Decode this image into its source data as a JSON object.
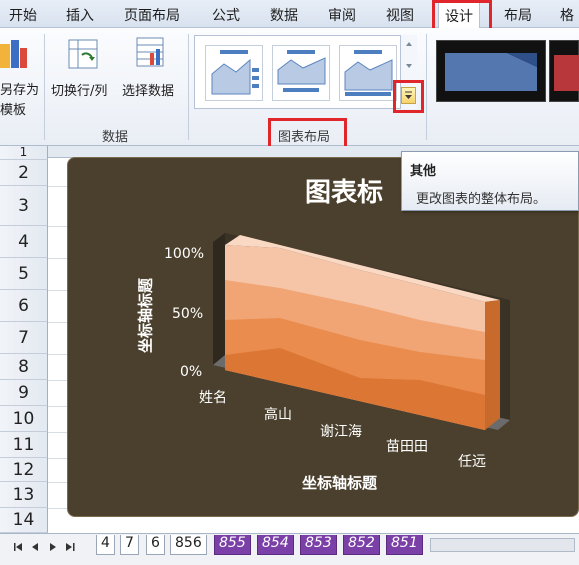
{
  "ribbon_tabs": [
    {
      "label": "开始"
    },
    {
      "label": "插入"
    },
    {
      "label": "页面布局"
    },
    {
      "label": "公式"
    },
    {
      "label": "数据"
    },
    {
      "label": "审阅"
    },
    {
      "label": "视图"
    },
    {
      "label": "设计",
      "active": true
    },
    {
      "label": "布局"
    },
    {
      "label": "格"
    }
  ],
  "ribbon": {
    "save_template_line1": "另存为",
    "save_template_line2": "模板",
    "switch_row_col": "切换行/列",
    "select_data": "选择数据",
    "group_data": "数据",
    "group_chart_layouts": "图表布局"
  },
  "tooltip": {
    "title": "其他",
    "description": "更改图表的整体布局。"
  },
  "rows": [
    "1",
    "2",
    "3",
    "4",
    "5",
    "6",
    "7",
    "8",
    "9",
    "10",
    "11",
    "12",
    "13",
    "14"
  ],
  "chart_data": {
    "type": "area",
    "title": "图表标",
    "xlabel": "坐标轴标题",
    "ylabel": "坐标轴标题",
    "categories": [
      "姓名",
      "高山",
      "谢江海",
      "苗田田",
      "任远"
    ],
    "y_ticks": [
      "100%",
      "50%",
      "0%"
    ],
    "ylim": [
      0,
      1
    ]
  },
  "sheet_tabs": [
    {
      "label": "4"
    },
    {
      "label": "7"
    },
    {
      "label": "6"
    },
    {
      "label": "856",
      "selected": true
    },
    {
      "label": "855"
    },
    {
      "label": "854"
    },
    {
      "label": "853"
    },
    {
      "label": "852"
    },
    {
      "label": "851"
    }
  ],
  "colors": {
    "accent_red": "#e0262b",
    "chart_bg": "#4b402d",
    "sheet_tab_purple": "#7b3fa8"
  }
}
